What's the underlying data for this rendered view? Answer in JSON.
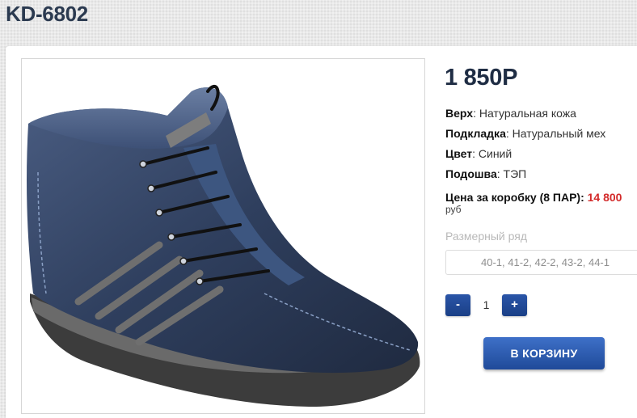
{
  "product": {
    "title": "KD-6802",
    "price": "1 850Р",
    "image_alt_icon": "boot-photo"
  },
  "specs": [
    {
      "label": "Верх",
      "value": ": Натуральная кожа"
    },
    {
      "label": "Подкладка",
      "value": ": Натуральный мех"
    },
    {
      "label": "Цвет",
      "value": ": Синий"
    },
    {
      "label": "Подошва",
      "value": ": ТЭП"
    }
  ],
  "box_price": {
    "label": "Цена за коробку (8 ПАР):",
    "value": "14 800",
    "currency": "руб"
  },
  "size": {
    "label": "Размерный ряд",
    "value": "40-1, 41-2, 42-2, 43-2, 44-1"
  },
  "quantity": {
    "minus_label": "-",
    "value": "1",
    "plus_label": "+"
  },
  "cart_button_label": "В КОРЗИНУ",
  "colors": {
    "accent": "#1f4a99",
    "price_red": "#d32a2a",
    "title": "#2b3a50"
  }
}
